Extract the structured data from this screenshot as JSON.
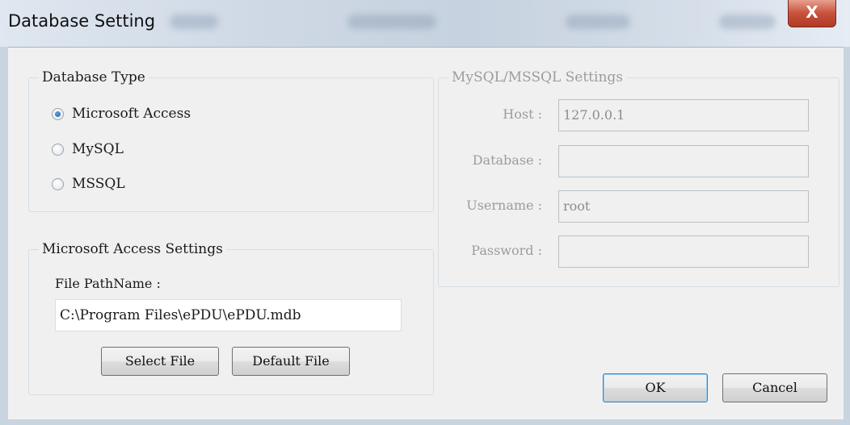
{
  "window": {
    "title": "Database Setting",
    "close_glyph": "X"
  },
  "database_type": {
    "group_label": "Database Type",
    "options": [
      {
        "label": "Microsoft Access",
        "selected": true
      },
      {
        "label": "MySQL",
        "selected": false
      },
      {
        "label": "MSSQL",
        "selected": false
      }
    ]
  },
  "access_settings": {
    "group_label": "Microsoft Access Settings",
    "file_label": "File PathName :",
    "file_value": "C:\\Program Files\\ePDU\\ePDU.mdb",
    "select_file_label": "Select File",
    "default_file_label": "Default File"
  },
  "sql_settings": {
    "group_label": "MySQL/MSSQL Settings",
    "enabled": false,
    "host_label": "Host :",
    "host_value": "127.0.0.1",
    "database_label": "Database :",
    "database_value": "",
    "username_label": "Username :",
    "username_value": "root",
    "password_label": "Password :",
    "password_value": ""
  },
  "buttons": {
    "ok_label": "OK",
    "cancel_label": "Cancel"
  },
  "colors": {
    "close_button": "#c8513b",
    "default_button_border": "#3c7fb1"
  }
}
